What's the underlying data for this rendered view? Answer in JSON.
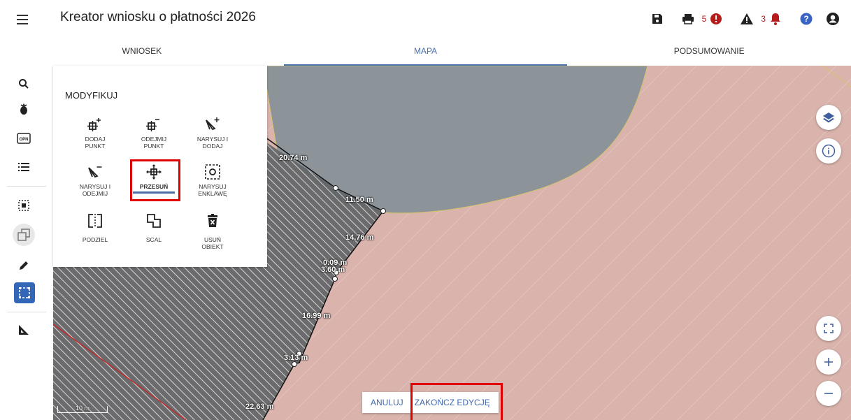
{
  "header": {
    "title": "Kreator wniosku o płatności 2026",
    "errors_count": "5",
    "warnings_count": "3"
  },
  "tabs": [
    {
      "label": "WNIOSEK"
    },
    {
      "label": "MAPA"
    },
    {
      "label": "PODSUMOWANIE"
    }
  ],
  "panel": {
    "title": "MODYFIKUJ",
    "tools": [
      {
        "label": "DODAJ PUNKT",
        "icon": "add-point-icon"
      },
      {
        "label": "ODEJMIJ PUNKT",
        "icon": "remove-point-icon"
      },
      {
        "label": "NARYSUJ I DODAJ",
        "icon": "draw-add-icon"
      },
      {
        "label": "NARYSUJ I ODEJMIJ",
        "icon": "draw-subtract-icon"
      },
      {
        "label": "PRZESUŃ",
        "icon": "move-icon"
      },
      {
        "label": "NARYSUJ ENKLAWĘ",
        "icon": "enclave-icon"
      },
      {
        "label": "PODZIEL",
        "icon": "split-icon"
      },
      {
        "label": "SCAL",
        "icon": "merge-icon"
      },
      {
        "label": "USUŃ OBIEKT",
        "icon": "delete-icon"
      }
    ]
  },
  "map": {
    "distances": [
      "20.74 m",
      "11.50 m",
      "14.76 m",
      "0.09 m",
      "3.60 m",
      "16.99 m",
      "3.13 m",
      "22.63 m"
    ],
    "scale_label": "10 m"
  },
  "actions": {
    "cancel": "ANULUJ",
    "finish": "ZAKOŃCZ EDYCJĘ"
  },
  "colors": {
    "accent": "#4a6fa5",
    "highlight": "#e10000",
    "error": "#b71c1c"
  }
}
